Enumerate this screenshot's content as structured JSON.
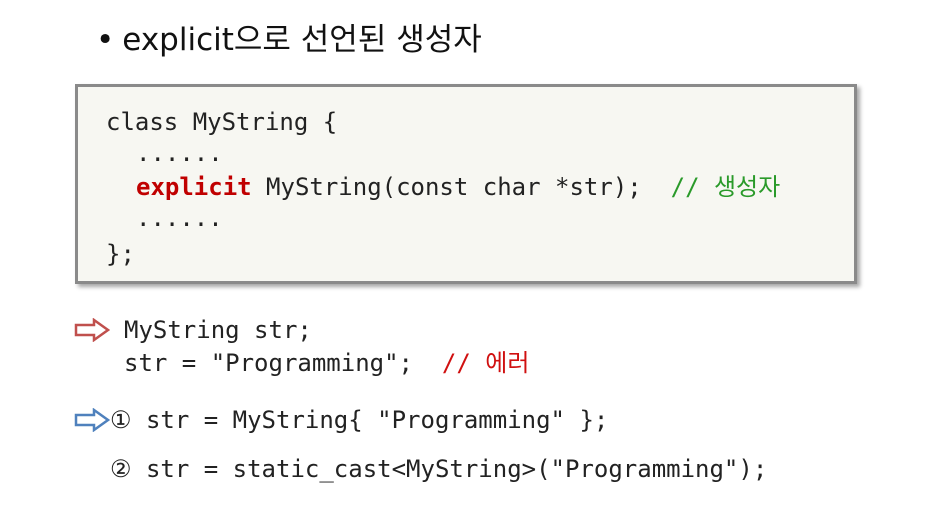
{
  "slide": {
    "bullet": "•",
    "title": "explicit으로 선언된 생성자"
  },
  "code": {
    "line1": "class MyString {",
    "line2": "......",
    "line3_kw": "explicit",
    "line3_rest": " MyString(const char *str);  ",
    "line3_comment": "// 생성자",
    "line4": "......",
    "line5": "};"
  },
  "examples": {
    "error_line1": "MyString str;",
    "error_line2": "str = \"Programming\";  ",
    "error_comment": "// 에러",
    "fix1": "① str = MyString{ \"Programming\" };",
    "fix2": "② str = static_cast<MyString>(\"Programming\");"
  },
  "colors": {
    "keyword": "#c00000",
    "comment_green": "#2a9a2a",
    "comment_red": "#d01010",
    "arrow_red": "#c0504d",
    "arrow_blue": "#4f81bd"
  },
  "icons": {
    "arrow1": "red-outline-arrow-icon",
    "arrow2": "blue-outline-arrow-icon"
  }
}
